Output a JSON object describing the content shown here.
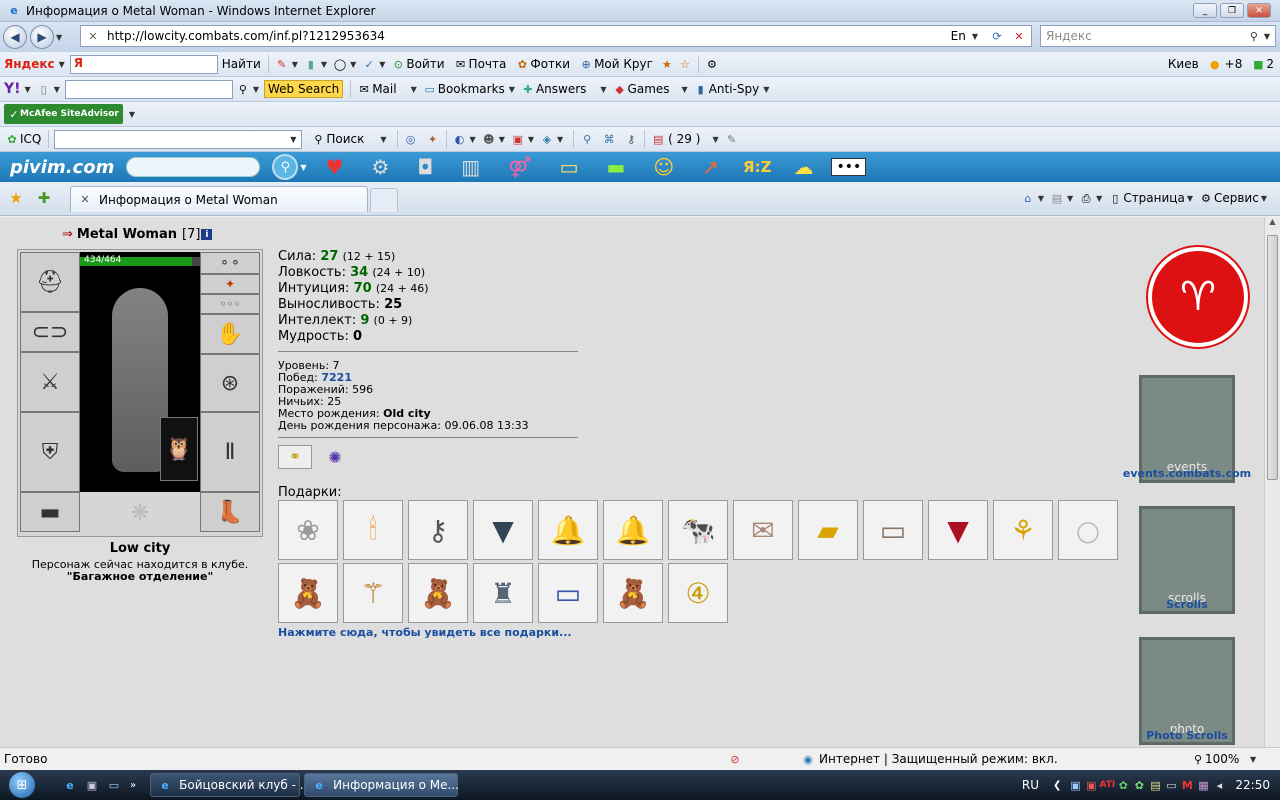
{
  "window": {
    "title": "Информация о Metal Woman - Windows Internet Explorer"
  },
  "address": {
    "url": "http://lowcity.combats.com/inf.pl?1212953634",
    "lang": "En",
    "search_placeholder": "Яндекс"
  },
  "yandex_bar": {
    "logo": "Яндекс",
    "find": "Найти",
    "login": "Войти",
    "mail": "Почта",
    "photos": "Фотки",
    "circle": "Мой Круг",
    "city": "Киев",
    "weather": "+8",
    "count": "2"
  },
  "yahoo_bar": {
    "web_search": "Web Search",
    "mail": "Mail",
    "bookmarks": "Bookmarks",
    "answers": "Answers",
    "games": "Games",
    "antispy": "Anti-Spy"
  },
  "mcafee": {
    "label": "McAfee SiteAdvisor"
  },
  "icq_bar": {
    "icq": "ICQ",
    "search": "Поиск",
    "counter": "( 29 )"
  },
  "pivim": {
    "logo": "pivim.com",
    "az": "Я:Z"
  },
  "tabs": {
    "active": "Информация о Metal Woman",
    "page": "Страница",
    "service": "Сервис"
  },
  "character": {
    "name": "Metal Woman",
    "level_badge": "[7]",
    "hp": "434/464",
    "hp_fraction": 0.935,
    "city": "Low city",
    "location_text": "Персонаж сейчас находится в клубе.",
    "location_place": "\"Багажное отделение\""
  },
  "stats": [
    {
      "label": "Сила:",
      "value": "27",
      "extra": "(12 + 15)"
    },
    {
      "label": "Ловкость:",
      "value": "34",
      "extra": "(24 + 10)"
    },
    {
      "label": "Интуиция:",
      "value": "70",
      "extra": "(24 + 46)"
    },
    {
      "label": "Выносливость:",
      "value": "25",
      "extra": ""
    },
    {
      "label": "Интеллект:",
      "value": "9",
      "extra": "(0 + 9)"
    },
    {
      "label": "Мудрость:",
      "value": "0",
      "extra": ""
    }
  ],
  "info": {
    "level": "Уровень: 7",
    "wins_label": "Побед:",
    "wins": "7221",
    "losses": "Поражений: 596",
    "draws": "Ничьих: 25",
    "birthplace_label": "Место рождения:",
    "birthplace": "Old city",
    "birthday": "День рождения персонажа: 09.06.08 13:33"
  },
  "gifts": {
    "title": "Подарки:",
    "show_all": "Нажмите сюда, чтобы увидеть все подарки..."
  },
  "right_links": {
    "events": "events.combats.com",
    "scrolls": "Scrolls",
    "photo": "Photo Scrolls",
    "banner_events": "events",
    "banner_scrolls": "scrolls",
    "banner_photo": "photo"
  },
  "status": {
    "text": "Готово",
    "zone": "Интернет | Защищенный режим: вкл.",
    "zoom": "100%"
  },
  "taskbar": {
    "task1": "Бойцовский клуб - ...",
    "task2": "Информация о Ме...",
    "lang": "RU",
    "time": "22:50"
  }
}
